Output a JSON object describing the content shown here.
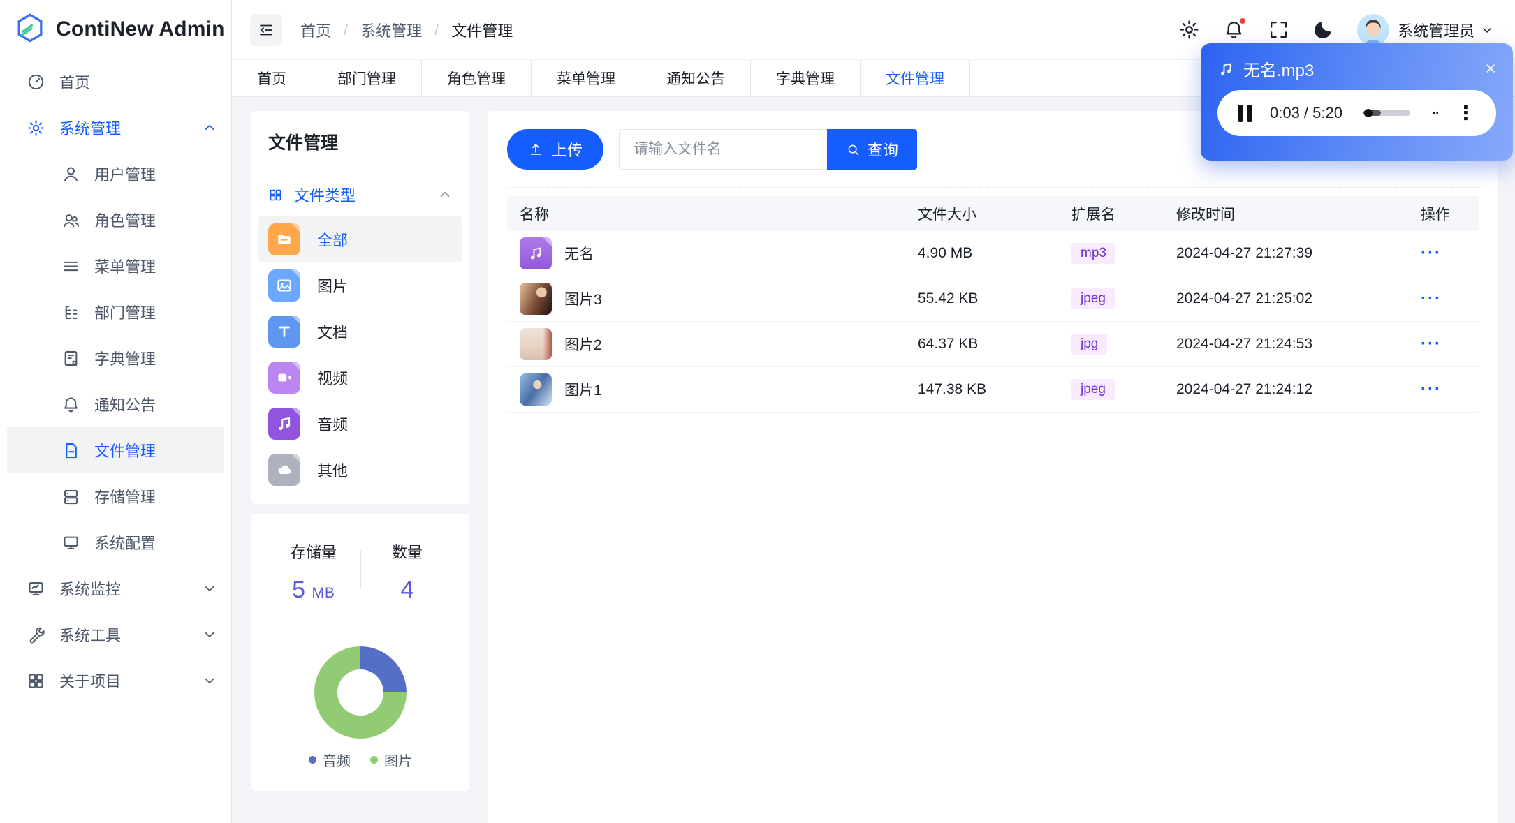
{
  "brand": {
    "name": "ContiNew Admin"
  },
  "header": {
    "breadcrumb": [
      "首页",
      "系统管理",
      "文件管理"
    ],
    "breadcrumb_separator": "/",
    "user_name": "系统管理员",
    "notification_dot": true,
    "icons": [
      "settings-icon",
      "notification-bell-icon",
      "fullscreen-icon",
      "dark-mode-moon-icon"
    ]
  },
  "sidebar": {
    "items": [
      {
        "label": "首页",
        "icon": "dashboard-icon"
      },
      {
        "label": "系统管理",
        "icon": "settings-gear-icon",
        "expanded": true
      },
      {
        "label": "用户管理",
        "icon": "user-icon"
      },
      {
        "label": "角色管理",
        "icon": "role-users-icon"
      },
      {
        "label": "菜单管理",
        "icon": "menu-list-icon"
      },
      {
        "label": "部门管理",
        "icon": "department-tree-icon"
      },
      {
        "label": "字典管理",
        "icon": "dictionary-icon"
      },
      {
        "label": "通知公告",
        "icon": "announcement-bell-icon"
      },
      {
        "label": "文件管理",
        "icon": "file-icon",
        "active": true
      },
      {
        "label": "存储管理",
        "icon": "storage-icon"
      },
      {
        "label": "系统配置",
        "icon": "system-config-icon"
      },
      {
        "label": "系统监控",
        "icon": "monitor-icon",
        "collapsed": true
      },
      {
        "label": "系统工具",
        "icon": "tools-wrench-icon",
        "collapsed": true
      },
      {
        "label": "关于项目",
        "icon": "about-grid-icon",
        "collapsed": true
      }
    ]
  },
  "tabs": {
    "items": [
      "首页",
      "部门管理",
      "角色管理",
      "菜单管理",
      "通知公告",
      "字典管理",
      "文件管理"
    ],
    "active": "文件管理"
  },
  "file_panel": {
    "title": "文件管理",
    "group_label": "文件类型",
    "active_type": "全部",
    "types": [
      {
        "label": "全部",
        "icon": "folder-icon",
        "color": "#FFA84B"
      },
      {
        "label": "图片",
        "icon": "image-icon",
        "color": "#6CA8FF"
      },
      {
        "label": "文档",
        "icon": "document-icon",
        "color": "#5E96F0"
      },
      {
        "label": "视频",
        "icon": "video-icon",
        "color": "#BB86F0"
      },
      {
        "label": "音频",
        "icon": "audio-icon",
        "color": "#9254DE"
      },
      {
        "label": "其他",
        "icon": "cloud-icon",
        "color": "#ADB2BC"
      }
    ]
  },
  "stats": {
    "storage_label": "存储量",
    "storage_value": "5",
    "storage_unit": "MB",
    "count_label": "数量",
    "count_value": "4"
  },
  "chart_data": {
    "type": "pie",
    "style": "donut",
    "labels": [
      "音频",
      "图片"
    ],
    "values": [
      1,
      3
    ],
    "percentages": [
      25,
      75
    ],
    "colors": [
      "#5470C6",
      "#91CC75"
    ],
    "legend_position": "bottom"
  },
  "toolbar": {
    "upload_label": "上传",
    "search_placeholder": "请输入文件名",
    "query_label": "查询"
  },
  "table": {
    "columns": [
      "名称",
      "文件大小",
      "扩展名",
      "修改时间",
      "操作"
    ],
    "actions_glyph": "···",
    "rows": [
      {
        "name": "无名",
        "size": "4.90 MB",
        "ext": "mp3",
        "modified": "2024-04-27 21:27:39"
      },
      {
        "name": "图片3",
        "size": "55.42 KB",
        "ext": "jpeg",
        "modified": "2024-04-27 21:25:02"
      },
      {
        "name": "图片2",
        "size": "64.37 KB",
        "ext": "jpg",
        "modified": "2024-04-27 21:24:53"
      },
      {
        "name": "图片1",
        "size": "147.38 KB",
        "ext": "jpeg",
        "modified": "2024-04-27 21:24:12"
      }
    ]
  },
  "player": {
    "title": "无名.mp3",
    "time": "0:03 / 5:20",
    "progress_pct": 38
  },
  "colors": {
    "primary": "#165DFF",
    "badge_bg": "#F9EBFF",
    "badge_text": "#722ED1",
    "stat_value": "#5A5BD5",
    "player_gradient": [
      "#2C63F1",
      "#87A9FA"
    ]
  }
}
